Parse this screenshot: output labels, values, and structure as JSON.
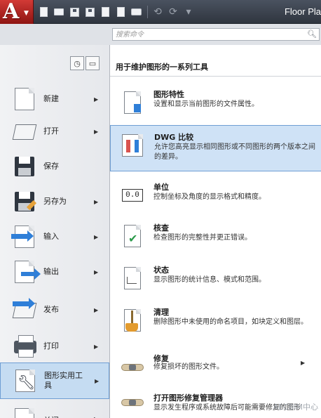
{
  "app": {
    "logo_letter": "A",
    "title": "Floor Pla"
  },
  "search": {
    "placeholder": "搜索命令"
  },
  "left_menu": [
    {
      "label": "新建",
      "icon": "new-document-icon",
      "has_submenu": true
    },
    {
      "label": "打开",
      "icon": "open-folder-icon",
      "has_submenu": true
    },
    {
      "label": "保存",
      "icon": "save-disk-icon",
      "has_submenu": false
    },
    {
      "label": "另存为",
      "icon": "save-as-icon",
      "has_submenu": true
    },
    {
      "label": "输入",
      "icon": "import-icon",
      "has_submenu": true
    },
    {
      "label": "输出",
      "icon": "export-icon",
      "has_submenu": true
    },
    {
      "label": "发布",
      "icon": "publish-icon",
      "has_submenu": true
    },
    {
      "label": "打印",
      "icon": "printer-icon",
      "has_submenu": true
    },
    {
      "label": "图形实用工具",
      "icon": "wrench-icon",
      "has_submenu": true,
      "active": true
    },
    {
      "label": "关闭",
      "icon": "close-document-icon",
      "has_submenu": true
    }
  ],
  "right_panel": {
    "header": "用于维护图形的一系列工具",
    "items": [
      {
        "title": "图形特性",
        "desc": "设置和显示当前图形的文件属性。",
        "icon": "drawing-properties-icon"
      },
      {
        "title": "DWG 比较",
        "desc": "允许您高亮显示相同图形或不同图形的两个版本之间的差异。",
        "icon": "dwg-compare-icon",
        "active": true
      },
      {
        "title": "单位",
        "desc": "控制坐标及角度的显示格式和精度。",
        "icon": "units-icon",
        "box_text": "0.0"
      },
      {
        "title": "核查",
        "desc": "检查图形的完整性并更正错误。",
        "icon": "audit-icon"
      },
      {
        "title": "状态",
        "desc": "显示图形的统计信息、模式和范围。",
        "icon": "status-icon"
      },
      {
        "title": "清理",
        "desc": "删除图形中未使用的命名项目，如块定义和图层。",
        "icon": "purge-icon"
      },
      {
        "title": "修复",
        "desc": "修复损坏的图形文件。",
        "icon": "recover-icon",
        "has_submenu": true
      },
      {
        "title": "打开图形修复管理器",
        "desc": "显示发生程序或系统故障后可能需要修复的图形",
        "icon": "drawing-recovery-manager-icon"
      }
    ]
  },
  "watermark": "AECBIM中心"
}
